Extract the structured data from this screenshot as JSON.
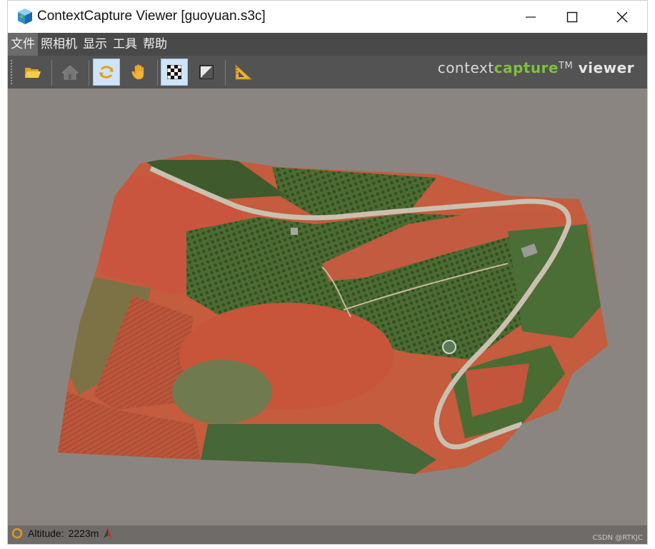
{
  "window": {
    "title": "ContextCapture Viewer [guoyuan.s3c]"
  },
  "menu": {
    "items": [
      "文件",
      "照相机",
      "显示",
      "工具",
      "帮助"
    ],
    "active_index": 0
  },
  "brand": {
    "prefix": "context",
    "accent": "capture",
    "tm": "TM",
    "suffix": " viewer"
  },
  "status": {
    "altitude_label": "Altitude:",
    "altitude_value": "2223m"
  },
  "watermark": "CSDN @RTKJC",
  "colors": {
    "menubar": "#494949",
    "toolbar": "#535353",
    "viewport": "#8b8581",
    "accent_green": "#7dc13a"
  },
  "toolbar_icons": [
    "open-folder-icon",
    "home-icon",
    "orbit-icon",
    "pan-hand-icon",
    "texture-checker-icon",
    "shading-icon",
    "measure-ruler-icon"
  ]
}
